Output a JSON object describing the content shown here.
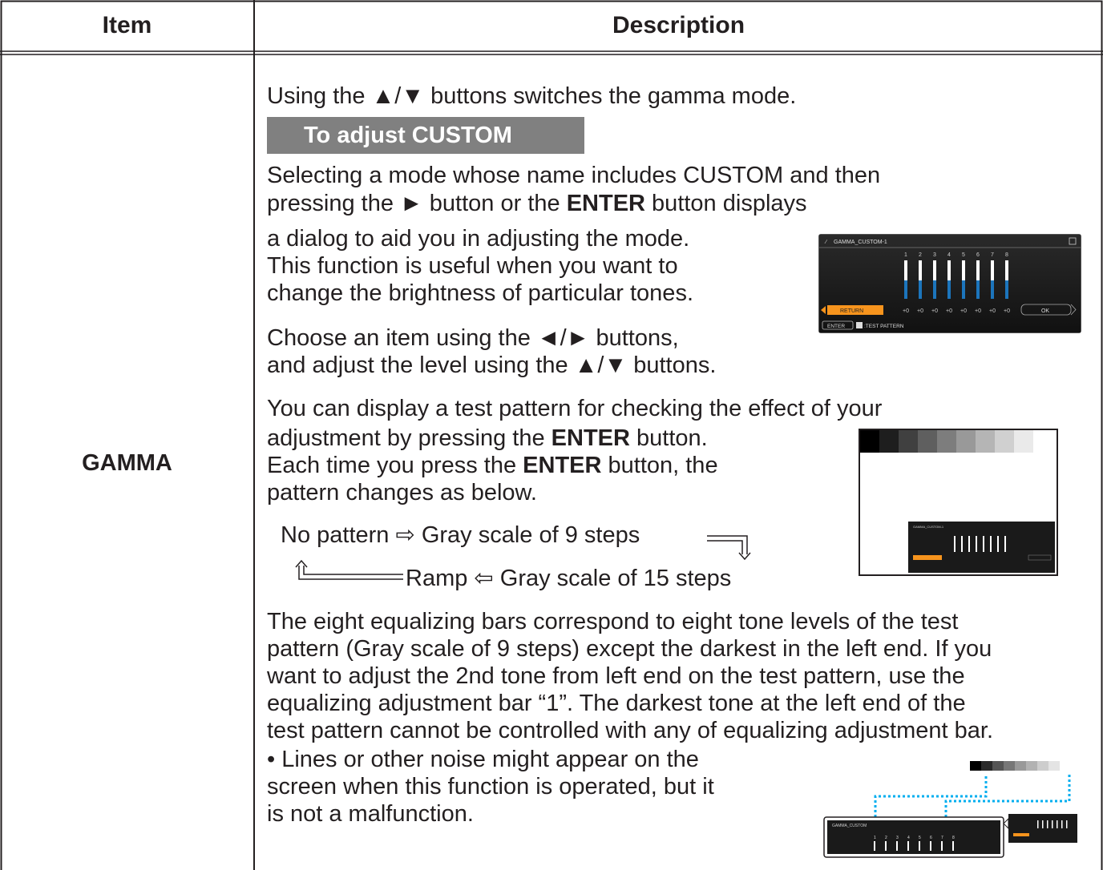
{
  "header": {
    "item": "Item",
    "description": "Description"
  },
  "row": {
    "item": "GAMMA",
    "intro": "Using the ▲/▼ buttons switches the gamma mode.",
    "custom_heading": "To adjust CUSTOM",
    "para1": [
      "Selecting a mode whose name includes CUSTOM and then",
      [
        "pressing the ► button or the ",
        "ENTER",
        " button displays"
      ],
      "a dialog to aid you in adjusting the mode.",
      "This function is useful when you want to",
      "change the brightness of particular tones."
    ],
    "para2": [
      "Choose an item using the ◄/► buttons,",
      "and adjust the level using the ▲/▼ buttons."
    ],
    "para3": [
      "You can display a test pattern for checking the effect of your",
      [
        "adjustment by pressing the ",
        "ENTER",
        " button."
      ],
      [
        "Each time you press the ",
        "ENTER",
        " button, the"
      ],
      "pattern changes as below."
    ],
    "flow1": "No pattern ⇨ Gray scale of 9 steps",
    "flow2": "Ramp ⇦ Gray scale of 15 steps",
    "para4": [
      "The eight equalizing bars correspond to eight tone levels of the test",
      "pattern (Gray scale of 9 steps) except the darkest in the left end. If you",
      "want to adjust the 2nd tone from left end on the test pattern, use the",
      "equalizing adjustment bar “1”. The darkest tone at the left end of the",
      "test pattern cannot be controlled with any of equalizing adjustment bar.",
      "• Lines or other noise might appear on the",
      "screen when this function is operated, but it",
      "is not a malfunction."
    ]
  },
  "dialog": {
    "title": "GAMMA_CUSTOM-1",
    "title_small": "GAMMA_CUSTOM",
    "bar_numbers": [
      "1",
      "2",
      "3",
      "4",
      "5",
      "6",
      "7",
      "8"
    ],
    "bar_values": [
      "+0",
      "+0",
      "+0",
      "+0",
      "+0",
      "+0",
      "+0",
      "+0"
    ],
    "return_label": "RETURN",
    "ok_label": "OK",
    "enter_label": "ENTER",
    "test_pattern_label": ":TEST PATTERN"
  },
  "colors": {
    "accent_orange": "#f7941d",
    "bar_blue": "#1c75bc",
    "dotted_blue": "#00aeef",
    "heading_gray": "#808080"
  }
}
